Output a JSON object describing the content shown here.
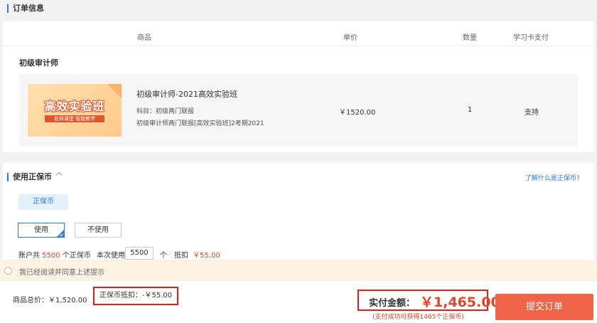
{
  "order_section": {
    "title": "订单信息",
    "headers": {
      "product": "商品",
      "unit_price": "单价",
      "quantity": "数量",
      "card_pay": "学习卡支付"
    },
    "category": "初级审计师",
    "item": {
      "thumb_title": "高效实验班",
      "thumb_tag": "名师课堂 智能教学",
      "name": "初级审计师-2021高效实验班",
      "subject": "科目：初级两门联报",
      "detail": "初级审计师两门联报[高效实验班]2考期2021",
      "price": "￥1520.00",
      "quantity": "1",
      "card_support": "支持"
    }
  },
  "coin_section": {
    "title": "使用正保币",
    "help_link": "了解什么是正保币?",
    "tab": "正保币",
    "options": {
      "use": "使用",
      "not_use": "不使用"
    },
    "account_prefix": "账户共",
    "account_amount": "5500",
    "account_suffix": "个正保币",
    "use_label": "本次使用",
    "use_value": "5500",
    "unit": "个",
    "deduct_label": "抵扣",
    "deduct_amount": "￥55.00"
  },
  "agreement": {
    "text": "我已经阅读并同意上述提示"
  },
  "summary": {
    "total_price": "商品总价：￥1,520.00",
    "coin_deduct": "正保币抵扣：-￥55.00",
    "pay_label": "实付金额：",
    "pay_amount": "￥1,465.00",
    "pay_note": "(支付成功可获得1465个正保币)",
    "submit": "提交订单"
  },
  "colors": {
    "accent": "#2a7ae2",
    "price_red": "#e0452b",
    "submit_bg": "#f06548",
    "highlight_border": "#e02020"
  }
}
